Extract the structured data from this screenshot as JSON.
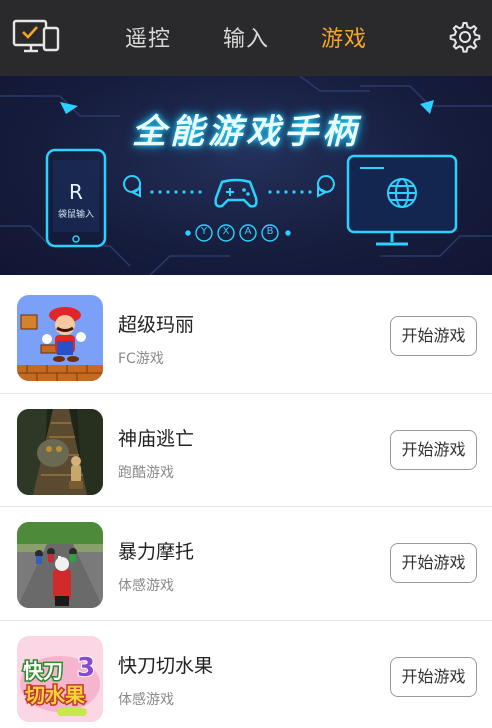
{
  "topbar": {
    "device_icon": "screen-and-phone-icon",
    "settings_icon": "gear-icon",
    "tabs": [
      {
        "label": "遥控",
        "active": false
      },
      {
        "label": "输入",
        "active": false
      },
      {
        "label": "游戏",
        "active": true
      }
    ],
    "active_color": "#f5a623"
  },
  "banner": {
    "title": "全能游戏手柄",
    "phone_caption": "袋鼠输入",
    "phone_logo": "R",
    "buttons": [
      "Y",
      "X",
      "A",
      "B"
    ],
    "gamepad_icon": "gamepad-icon",
    "globe_icon": "globe-icon"
  },
  "games": [
    {
      "name": "超级玛丽",
      "type": "FC游戏",
      "button": "开始游戏",
      "thumb": "super-mario"
    },
    {
      "name": "神庙逃亡",
      "type": "跑酷游戏",
      "button": "开始游戏",
      "thumb": "temple-run"
    },
    {
      "name": "暴力摩托",
      "type": "体感游戏",
      "button": "开始游戏",
      "thumb": "road-rash"
    },
    {
      "name": "快刀切水果",
      "type": "体感游戏",
      "button": "开始游戏",
      "thumb": "fruit-ninja"
    }
  ]
}
